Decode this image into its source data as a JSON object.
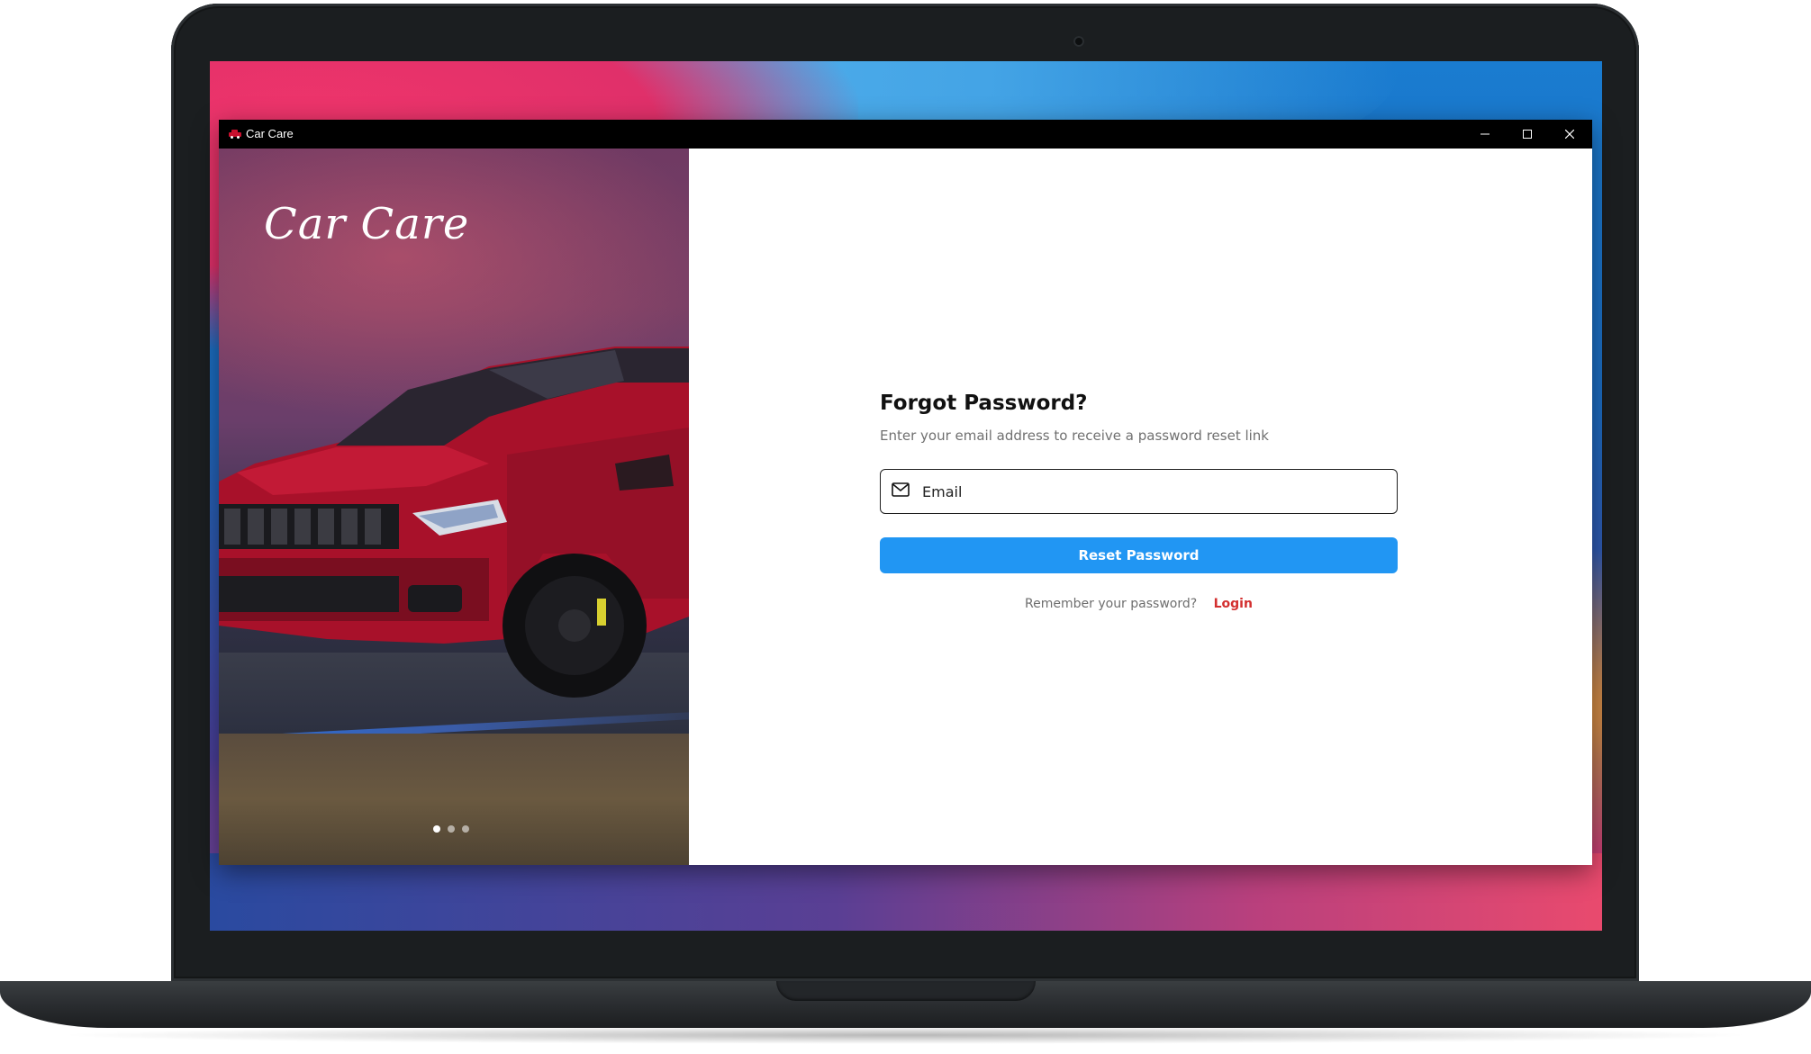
{
  "window": {
    "title": "Car Care",
    "controls": {
      "minimize_icon": "minimize-icon",
      "maximize_icon": "maximize-icon",
      "close_icon": "close-icon"
    }
  },
  "hero": {
    "brand_title": "Car Care",
    "carousel": {
      "total": 3,
      "active_index": 0
    }
  },
  "form": {
    "title": "Forgot Password?",
    "subtitle": "Enter your email address to receive a password reset link",
    "email": {
      "icon": "mail-icon",
      "placeholder": "Email",
      "value": ""
    },
    "reset_button_label": "Reset Password",
    "footer": {
      "remember_text": "Remember your password?",
      "login_label": "Login"
    }
  },
  "colors": {
    "primary_button": "#2196f3",
    "login_link": "#d32f2f",
    "titlebar": "#000000",
    "car": "#b3142a"
  }
}
